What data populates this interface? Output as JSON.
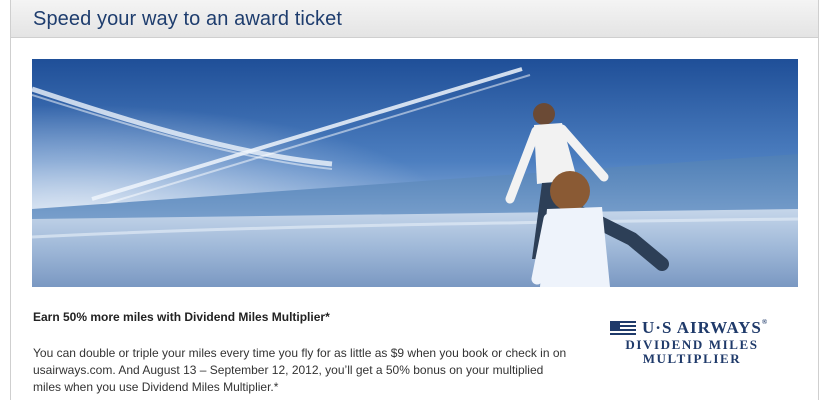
{
  "header": {
    "title": "Speed your way to an award ticket"
  },
  "hero": {
    "image_name": "beach-family-contrails-photo"
  },
  "promo": {
    "heading": "Earn 50% more miles with Dividend Miles Multiplier*",
    "body": "You can double or triple your miles every time you fly for as little as $9 when you book or check in on usairways.com. And August 13 – September 12, 2012, you’ll get a 50% bonus on your multiplied miles when you use Dividend Miles Multiplier.*"
  },
  "logo": {
    "brand": "U·S AIRWAYS",
    "registered": "®",
    "line2": "DIVIDEND MILES",
    "line3": "MULTIPLIER"
  },
  "colors": {
    "title": "#1e3d6e",
    "brand_navy": "#1f3a6a",
    "sky_top": "#2b5fa8",
    "sea": "#5f8cc0"
  }
}
